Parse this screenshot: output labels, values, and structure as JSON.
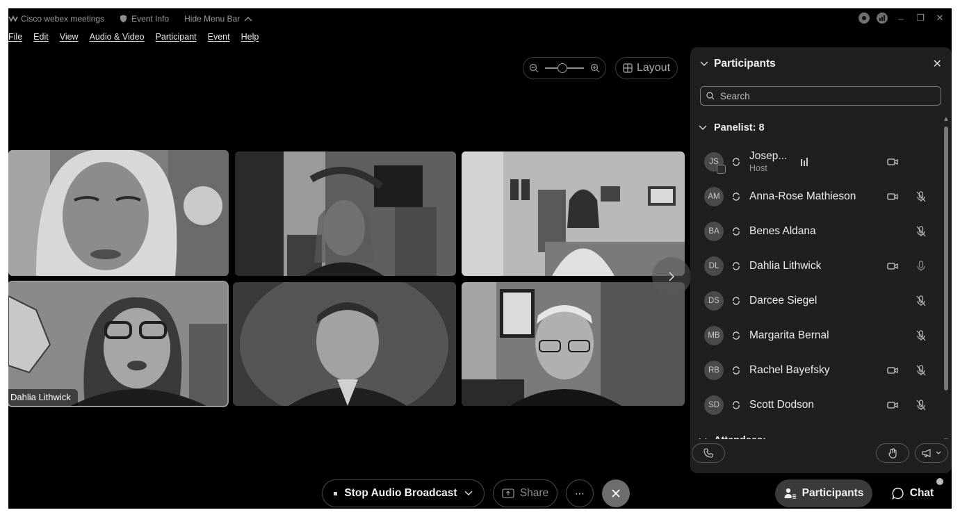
{
  "titlebar": {
    "app_name": "Cisco webex meetings",
    "event_info": "Event Info",
    "hide_menu": "Hide Menu Bar"
  },
  "menu": [
    "File",
    "Edit",
    "View",
    "Audio & Video",
    "Participant",
    "Event",
    "Help"
  ],
  "toolbar": {
    "layout_label": "Layout"
  },
  "video": {
    "active_speaker_name": "Dahlia Lithwick"
  },
  "participants_panel": {
    "title": "Participants",
    "search_placeholder": "Search",
    "panelist_section": "Panelist: 8",
    "attendees_section": "Attendees:",
    "participants": [
      {
        "initials": "JS",
        "name": "Josep...",
        "role": "Host",
        "speaking": true,
        "camera": true,
        "mic_muted": false,
        "mic": false
      },
      {
        "initials": "AM",
        "name": "Anna-Rose Mathieson",
        "camera": true,
        "mic_muted": true
      },
      {
        "initials": "BA",
        "name": "Benes Aldana",
        "camera": false,
        "mic_muted": true
      },
      {
        "initials": "DL",
        "name": "Dahlia Lithwick",
        "camera": true,
        "mic_muted": false,
        "mic": true
      },
      {
        "initials": "DS",
        "name": "Darcee Siegel",
        "camera": false,
        "mic_muted": true
      },
      {
        "initials": "MB",
        "name": "Margarita Bernal",
        "camera": false,
        "mic_muted": true
      },
      {
        "initials": "RB",
        "name": "Rachel Bayefsky",
        "camera": true,
        "mic_muted": true
      },
      {
        "initials": "SD",
        "name": "Scott Dodson",
        "camera": true,
        "mic_muted": true
      }
    ]
  },
  "controls": {
    "audio_broadcast": "Stop Audio Broadcast",
    "share": "Share",
    "participants": "Participants",
    "chat": "Chat"
  }
}
